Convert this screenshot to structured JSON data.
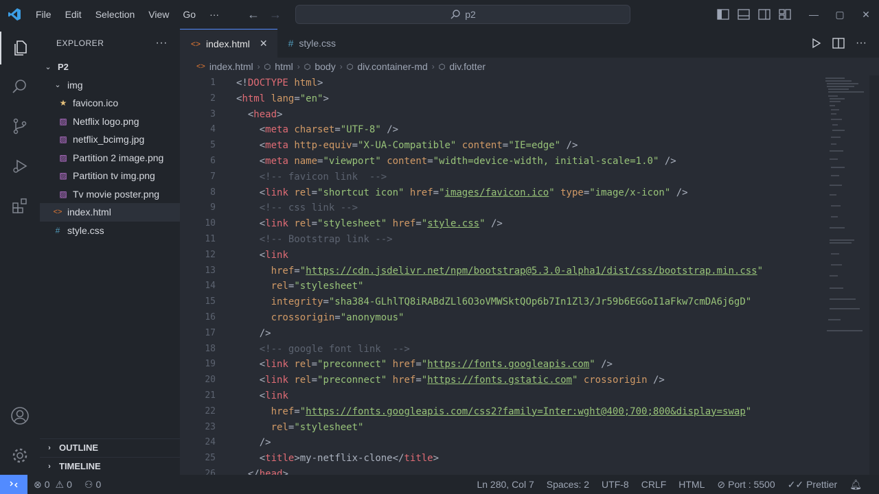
{
  "menu": [
    "File",
    "Edit",
    "Selection",
    "View",
    "Go",
    "···"
  ],
  "search": {
    "text": "p2"
  },
  "window_controls": {
    "minimize": "—",
    "maximize": "▢",
    "close": "✕"
  },
  "explorer": {
    "title": "EXPLORER",
    "more": "···",
    "root": "P2",
    "folder": "img",
    "files_in_folder": [
      "favicon.ico",
      "Netflix logo.png",
      "netflix_bcimg.jpg",
      "Partition 2 image.png",
      "Partition tv img.png",
      "Tv movie poster.png"
    ],
    "root_files": [
      "index.html",
      "style.css"
    ],
    "outline": "OUTLINE",
    "timeline": "TIMELINE"
  },
  "tabs": [
    {
      "label": "index.html",
      "icon": "<>",
      "close": "✕"
    },
    {
      "label": "style.css",
      "icon": "#"
    }
  ],
  "breadcrumb": [
    "index.html",
    "html",
    "body",
    "div.container-md",
    "div.fotter"
  ],
  "status": {
    "errors": "0",
    "warnings": "0",
    "ports": "0",
    "position": "Ln 280, Col 7",
    "spaces": "Spaces: 2",
    "encoding": "UTF-8",
    "eol": "CRLF",
    "language": "HTML",
    "port": "Port : 5500",
    "formatter": "Prettier"
  },
  "code_lines": [
    "1",
    "2",
    "3",
    "4",
    "5",
    "6",
    "7",
    "8",
    "9",
    "10",
    "11",
    "12",
    "13",
    "14",
    "15",
    "16",
    "17",
    "18",
    "19",
    "20",
    "21",
    "22",
    "23",
    "24",
    "25",
    "26"
  ],
  "colors": {
    "accent": "#528bff",
    "tag": "#e06c75",
    "attr": "#d19a66",
    "string": "#98c379",
    "comment": "#5c6370"
  }
}
